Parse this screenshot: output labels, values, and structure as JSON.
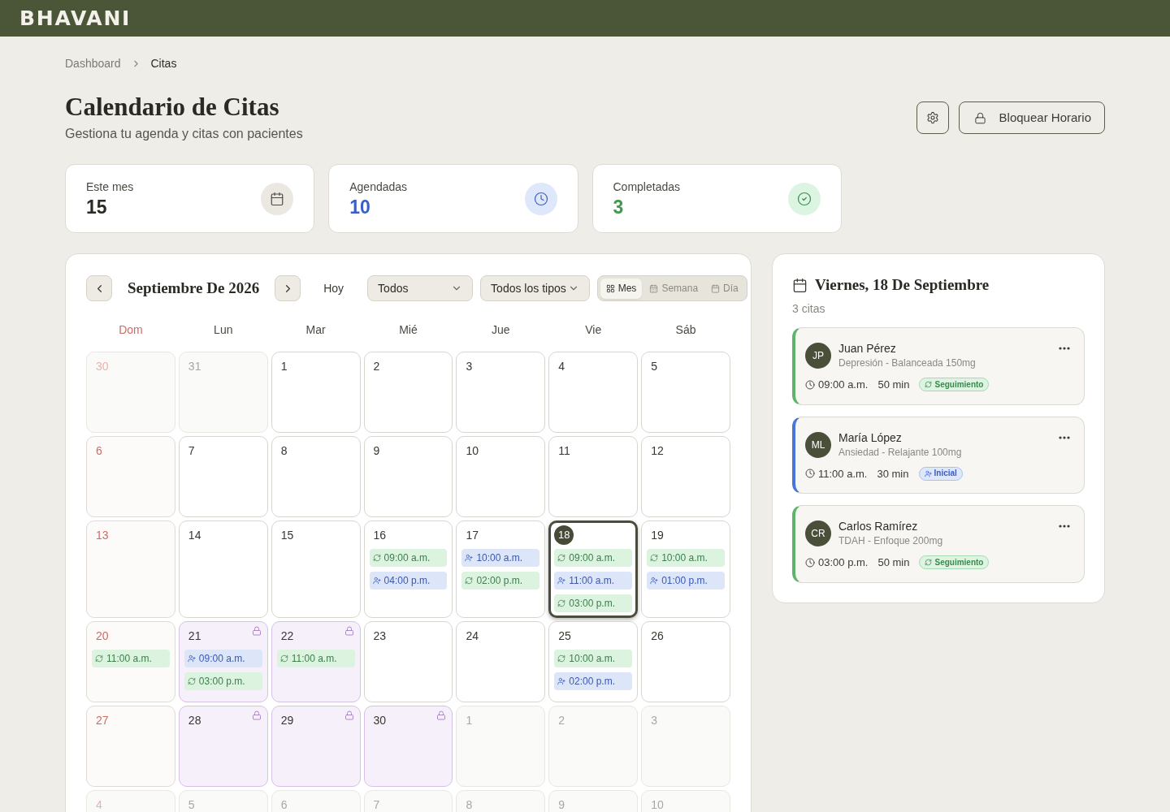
{
  "header": {
    "logo": "BHAVANI"
  },
  "breadcrumb": [
    {
      "label": "Dashboard",
      "current": false
    },
    {
      "label": "Citas",
      "current": true
    }
  ],
  "page": {
    "title": "Calendario de Citas",
    "subtitle": "Gestiona tu agenda y citas con pacientes"
  },
  "actions": [
    {
      "kind": "settings"
    },
    {
      "kind": "block",
      "label": "Bloquear Horario"
    }
  ],
  "stats": [
    {
      "label": "Este mes",
      "value": "15",
      "kind": "month"
    },
    {
      "label": "Agendadas",
      "value": "10",
      "kind": "scheduled"
    },
    {
      "label": "Completadas",
      "value": "3",
      "kind": "completed"
    }
  ],
  "calendar": {
    "title": "Septiembre De 2026",
    "today": "Hoy",
    "filters": [
      {
        "value": "Todos"
      },
      {
        "value": "Todos los tipos"
      }
    ],
    "views": [
      {
        "label": "Mes",
        "kind": "month",
        "selected": true
      },
      {
        "label": "Semana",
        "kind": "week",
        "selected": false
      },
      {
        "label": "Día",
        "kind": "day",
        "selected": false
      }
    ],
    "weekdays": [
      {
        "label": "Dom",
        "sunday": true
      },
      {
        "label": "Lun",
        "sunday": false
      },
      {
        "label": "Mar",
        "sunday": false
      },
      {
        "label": "Mié",
        "sunday": false
      },
      {
        "label": "Jue",
        "sunday": false
      },
      {
        "label": "Vie",
        "sunday": false
      },
      {
        "label": "Sáb",
        "sunday": false
      }
    ],
    "weeks": [
      [
        {
          "day": "30",
          "outside": true,
          "blocked": false,
          "selected": false
        },
        {
          "day": "31",
          "outside": true,
          "blocked": false,
          "selected": false
        },
        {
          "day": "1",
          "outside": false,
          "blocked": false,
          "selected": false
        },
        {
          "day": "2",
          "outside": false,
          "blocked": false,
          "selected": false
        },
        {
          "day": "3",
          "outside": false,
          "blocked": false,
          "selected": false
        },
        {
          "day": "4",
          "outside": false,
          "blocked": false,
          "selected": false
        },
        {
          "day": "5",
          "outside": false,
          "blocked": false,
          "selected": false
        }
      ],
      [
        {
          "day": "6",
          "outside": false,
          "blocked": false,
          "selected": false
        },
        {
          "day": "7",
          "outside": false,
          "blocked": false,
          "selected": false
        },
        {
          "day": "8",
          "outside": false,
          "blocked": false,
          "selected": false
        },
        {
          "day": "9",
          "outside": false,
          "blocked": false,
          "selected": false
        },
        {
          "day": "10",
          "outside": false,
          "blocked": false,
          "selected": false
        },
        {
          "day": "11",
          "outside": false,
          "blocked": false,
          "selected": false
        },
        {
          "day": "12",
          "outside": false,
          "blocked": false,
          "selected": false
        }
      ],
      [
        {
          "day": "13",
          "outside": false,
          "blocked": false,
          "selected": false
        },
        {
          "day": "14",
          "outside": false,
          "blocked": false,
          "selected": false
        },
        {
          "day": "15",
          "outside": false,
          "blocked": false,
          "selected": false
        },
        {
          "day": "16",
          "outside": false,
          "blocked": false,
          "selected": false,
          "events": [
            {
              "kind": "followup",
              "time": "09:00 a.m."
            },
            {
              "kind": "initial",
              "time": "04:00 p.m."
            }
          ]
        },
        {
          "day": "17",
          "outside": false,
          "blocked": false,
          "selected": false,
          "events": [
            {
              "kind": "initial",
              "time": "10:00 a.m."
            },
            {
              "kind": "followup",
              "time": "02:00 p.m."
            }
          ]
        },
        {
          "day": "18",
          "outside": false,
          "blocked": false,
          "selected": true,
          "events": [
            {
              "kind": "followup",
              "time": "09:00 a.m."
            },
            {
              "kind": "initial",
              "time": "11:00 a.m."
            },
            {
              "kind": "followup",
              "time": "03:00 p.m."
            }
          ]
        },
        {
          "day": "19",
          "outside": false,
          "blocked": false,
          "selected": false,
          "events": [
            {
              "kind": "followup",
              "time": "10:00 a.m."
            },
            {
              "kind": "initial",
              "time": "01:00 p.m."
            }
          ]
        }
      ],
      [
        {
          "day": "20",
          "outside": false,
          "blocked": false,
          "selected": false,
          "events": [
            {
              "kind": "followup",
              "time": "11:00 a.m."
            }
          ]
        },
        {
          "day": "21",
          "outside": false,
          "blocked": true,
          "selected": false,
          "events": [
            {
              "kind": "initial",
              "time": "09:00 a.m."
            },
            {
              "kind": "followup",
              "time": "03:00 p.m."
            }
          ]
        },
        {
          "day": "22",
          "outside": false,
          "blocked": true,
          "selected": false,
          "events": [
            {
              "kind": "followup",
              "time": "11:00 a.m."
            }
          ]
        },
        {
          "day": "23",
          "outside": false,
          "blocked": false,
          "selected": false
        },
        {
          "day": "24",
          "outside": false,
          "blocked": false,
          "selected": false
        },
        {
          "day": "25",
          "outside": false,
          "blocked": false,
          "selected": false,
          "events": [
            {
              "kind": "followup",
              "time": "10:00 a.m."
            },
            {
              "kind": "initial",
              "time": "02:00 p.m."
            }
          ]
        },
        {
          "day": "26",
          "outside": false,
          "blocked": false,
          "selected": false
        }
      ],
      [
        {
          "day": "27",
          "outside": false,
          "blocked": false,
          "selected": false
        },
        {
          "day": "28",
          "outside": false,
          "blocked": true,
          "selected": false
        },
        {
          "day": "29",
          "outside": false,
          "blocked": true,
          "selected": false
        },
        {
          "day": "30",
          "outside": false,
          "blocked": true,
          "selected": false
        },
        {
          "day": "1",
          "outside": true,
          "blocked": false,
          "selected": false
        },
        {
          "day": "2",
          "outside": true,
          "blocked": false,
          "selected": false
        },
        {
          "day": "3",
          "outside": true,
          "blocked": false,
          "selected": false
        }
      ],
      [
        {
          "day": "4",
          "outside": true,
          "blocked": false,
          "selected": false
        },
        {
          "day": "5",
          "outside": true,
          "blocked": false,
          "selected": false
        },
        {
          "day": "6",
          "outside": true,
          "blocked": false,
          "selected": false
        },
        {
          "day": "7",
          "outside": true,
          "blocked": false,
          "selected": false
        },
        {
          "day": "8",
          "outside": true,
          "blocked": false,
          "selected": false
        },
        {
          "day": "9",
          "outside": true,
          "blocked": false,
          "selected": false
        },
        {
          "day": "10",
          "outside": true,
          "blocked": false,
          "selected": false
        }
      ]
    ]
  },
  "day_panel": {
    "title": "Viernes, 18 De Septiembre",
    "count": "3 citas",
    "appointments": [
      {
        "initials": "JP",
        "name": "Juan Pérez",
        "detail": "Depresión - Balanceada 150mg",
        "time": "09:00 a.m.",
        "duration": "50 min",
        "kind": "followup",
        "badge": "Seguimiento"
      },
      {
        "initials": "ML",
        "name": "María López",
        "detail": "Ansiedad - Relajante 100mg",
        "time": "11:00 a.m.",
        "duration": "30 min",
        "kind": "initial",
        "badge": "Inicial"
      },
      {
        "initials": "CR",
        "name": "Carlos Ramírez",
        "detail": "TDAH - Enfoque 200mg",
        "time": "03:00 p.m.",
        "duration": "50 min",
        "kind": "followup",
        "badge": "Seguimiento"
      }
    ]
  }
}
